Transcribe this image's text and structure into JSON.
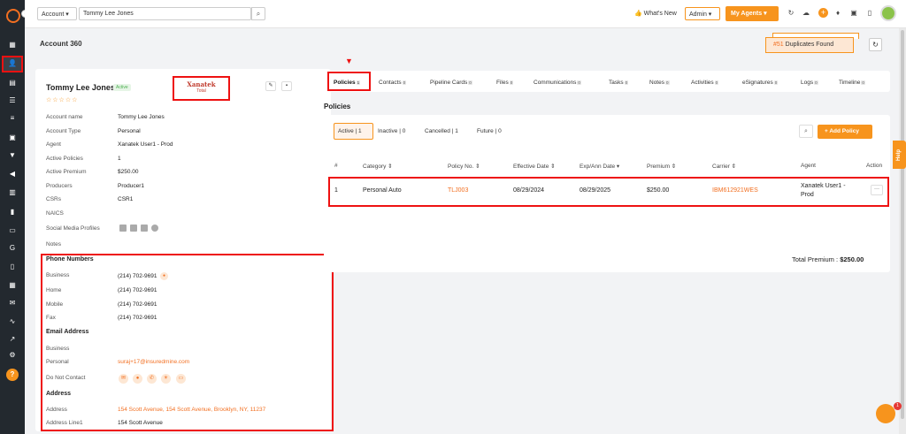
{
  "topbar": {
    "account_select": "Account",
    "search_value": "Tommy Lee Jones",
    "whats_new": "What's New",
    "admin_select": "Admin",
    "my_agents": "My Agents"
  },
  "page": {
    "title": "Account 360",
    "duplicates_count": "#51",
    "duplicates_label": "Duplicates Found"
  },
  "profile": {
    "name": "Tommy Lee Jones",
    "status": "Active",
    "stars": "☆☆☆☆☆",
    "logo_line1": "Xanatek",
    "logo_line2": "Total",
    "fields": [
      {
        "label": "Account name",
        "value": "Tommy Lee Jones"
      },
      {
        "label": "Account Type",
        "value": "Personal"
      },
      {
        "label": "Agent",
        "value": "Xanatek User1 - Prod"
      },
      {
        "label": "Active Policies",
        "value": "1"
      },
      {
        "label": "Active Premium",
        "value": "$250.00"
      },
      {
        "label": "Producers",
        "value": "Producer1"
      },
      {
        "label": "CSRs",
        "value": "CSR1"
      },
      {
        "label": "NAICS",
        "value": ""
      },
      {
        "label": "Social Media Profiles",
        "value": ""
      },
      {
        "label": "Notes",
        "value": ""
      }
    ],
    "phone_heading": "Phone Numbers",
    "phones": [
      {
        "label": "Business",
        "value": "(214) 702-9691"
      },
      {
        "label": "Home",
        "value": "(214) 702-9691"
      },
      {
        "label": "Mobile",
        "value": "(214) 702-9691"
      },
      {
        "label": "Fax",
        "value": "(214) 702-9691"
      }
    ],
    "email_heading": "Email Address",
    "emails": [
      {
        "label": "Business",
        "value": ""
      },
      {
        "label": "Personal",
        "value": "suraj+17@insuredmine.com"
      }
    ],
    "dnc_label": "Do Not Contact",
    "address_heading": "Address",
    "addresses": [
      {
        "label": "Address",
        "value": "154 Scott Avenue, 154 Scott Avenue, Brooklyn, NY, 11237"
      },
      {
        "label": "Address Line1",
        "value": "154 Scott Avenue"
      }
    ]
  },
  "tabs": [
    {
      "label": "Policies",
      "count": "1"
    },
    {
      "label": "Contacts",
      "count": "0"
    },
    {
      "label": "Pipeline Cards",
      "count": "0"
    },
    {
      "label": "Files",
      "count": "0"
    },
    {
      "label": "Communications",
      "count": "0"
    },
    {
      "label": "Tasks",
      "count": "0"
    },
    {
      "label": "Notes",
      "count": "0"
    },
    {
      "label": "Activities",
      "count": "0"
    },
    {
      "label": "eSignatures",
      "count": "0"
    },
    {
      "label": "Logs",
      "count": "0"
    },
    {
      "label": "Timeline",
      "count": "0"
    }
  ],
  "policies": {
    "title": "Policies",
    "filters": {
      "active": "Active",
      "active_count": "1",
      "inactive": "Inactive",
      "inactive_count": "0",
      "cancelled": "Cancelled",
      "cancelled_count": "1",
      "future": "Future",
      "future_count": "0"
    },
    "add_label": "+ Add Policy",
    "columns": [
      "#",
      "Category ⇕",
      "Policy No. ⇕",
      "Effective Date ⇕",
      "Exp/Ann Date ▾",
      "Premium ⇕",
      "Carrier ⇕",
      "Agent",
      "Action"
    ],
    "rows": [
      {
        "num": "1",
        "category": "Personal Auto",
        "policy_no": "TLJ003",
        "effective": "08/29/2024",
        "exp": "08/29/2025",
        "premium": "$250.00",
        "carrier": "IBM612921WES",
        "agent_line1": "Xanatek User1 -",
        "agent_line2": "Prod"
      }
    ],
    "total_label": "Total Premium :",
    "total_value": "$250.00"
  },
  "help": "Help",
  "chat_badge": "1",
  "colors": {
    "accent": "#f7941d",
    "highlight": "#ee1111",
    "sidebar": "#23292f"
  }
}
